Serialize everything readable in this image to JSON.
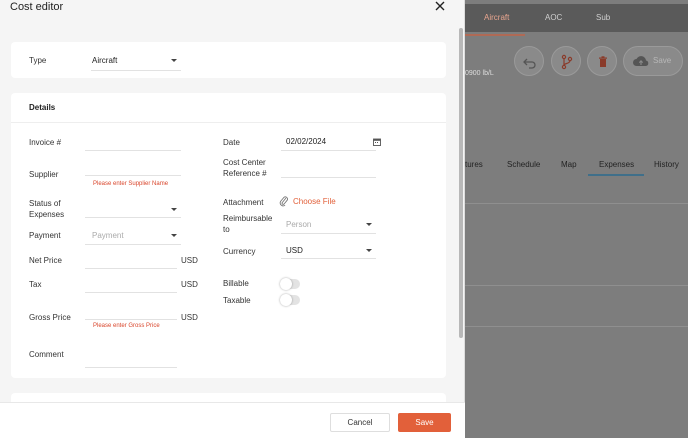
{
  "drawer": {
    "title": "Cost editor",
    "close_icon": "close-icon"
  },
  "type_card": {
    "label": "Type",
    "value": "Aircraft"
  },
  "details": {
    "title": "Details",
    "left": {
      "invoice_label": "Invoice #",
      "supplier_label": "Supplier",
      "supplier_error": "Please enter Supplier Name",
      "status_label": "Status of Expenses",
      "payment_label": "Payment",
      "payment_placeholder": "Payment",
      "net_price_label": "Net Price",
      "net_price_unit": "USD",
      "tax_label": "Tax",
      "tax_unit": "USD",
      "gross_price_label": "Gross Price",
      "gross_price_unit": "USD",
      "gross_price_error": "Please enter Gross Price",
      "comment_label": "Comment"
    },
    "right": {
      "date_label": "Date",
      "date_value": "02/02/2024",
      "cost_center_label": "Cost Center Reference #",
      "attachment_label": "Attachment",
      "choose_file": "Choose File",
      "reimbursable_label": "Reimbursable to",
      "reimbursable_placeholder": "Person",
      "currency_label": "Currency",
      "currency_value": "USD",
      "billable_label": "Billable",
      "billable_on": false,
      "taxable_label": "Taxable",
      "taxable_on": false
    }
  },
  "footer": {
    "cancel_label": "Cancel",
    "save_label": "Save"
  },
  "background": {
    "tabs": [
      "Aircraft",
      "AOC",
      "Sub"
    ],
    "weight_text": "0900 lb/L",
    "save_label": "Save",
    "subtabs": [
      "tures",
      "Schedule",
      "Map",
      "Expenses",
      "History"
    ],
    "active_subtab": "Expenses"
  },
  "colors": {
    "accent": "#e2603a",
    "error": "#d9452b",
    "attachment_link": "#e2603a"
  }
}
